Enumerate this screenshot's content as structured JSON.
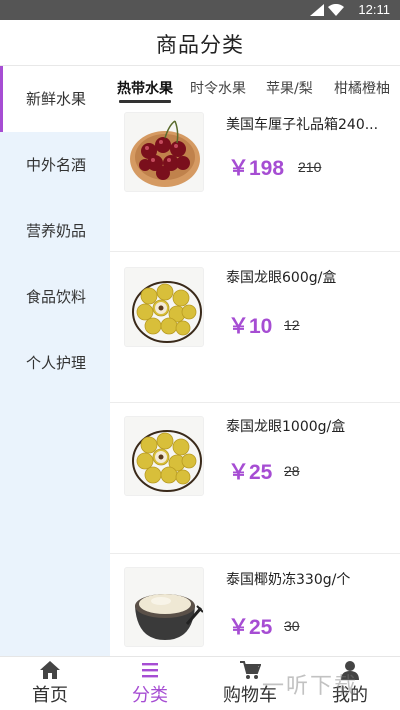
{
  "status_bar": {
    "time": "12:11",
    "icons": [
      "signal-icon",
      "wifi-icon"
    ]
  },
  "header": {
    "title": "商品分类"
  },
  "sidebar": {
    "active_index": 0,
    "items": [
      {
        "label": "新鲜水果"
      },
      {
        "label": "中外名酒"
      },
      {
        "label": "营养奶品"
      },
      {
        "label": "食品饮料"
      },
      {
        "label": "个人护理"
      }
    ]
  },
  "tabs": {
    "active_index": 0,
    "items": [
      {
        "label": "热带水果"
      },
      {
        "label": "时令水果"
      },
      {
        "label": "苹果/梨"
      },
      {
        "label": "柑橘橙柚"
      }
    ]
  },
  "products": [
    {
      "name": "美国车厘子礼品箱240...",
      "price": "￥198",
      "old_price": "210",
      "image": "cherries-image"
    },
    {
      "name": "泰国龙眼600g/盒",
      "price": "￥10",
      "old_price": "12",
      "image": "longan-image"
    },
    {
      "name": "泰国龙眼1000g/盒",
      "price": "￥25",
      "old_price": "28",
      "image": "longan-image"
    },
    {
      "name": "泰国椰奶冻330g/个",
      "price": "￥25",
      "old_price": "30",
      "image": "coconut-pudding-image"
    }
  ],
  "tab_bar": {
    "active_index": 1,
    "items": [
      {
        "label": "首页",
        "icon": "home-icon"
      },
      {
        "label": "分类",
        "icon": "menu-icon"
      },
      {
        "label": "购物车",
        "icon": "cart-icon"
      },
      {
        "label": "我的",
        "icon": "user-icon"
      }
    ]
  },
  "watermark": {
    "text": "一听下载"
  },
  "colors": {
    "accent": "#a64dd3",
    "sidebar_bg": "#eaf3fc",
    "status_bar_bg": "#555555"
  }
}
